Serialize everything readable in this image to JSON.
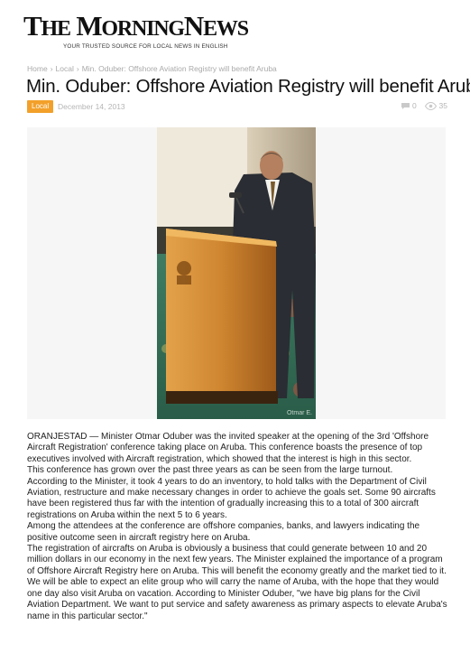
{
  "site": {
    "logo_the": "The",
    "logo_name": "MorningNews",
    "tagline": "YOUR TRUSTED SOURCE FOR LOCAL NEWS IN ENGLISH"
  },
  "breadcrumb": {
    "home": "Home",
    "section": "Local",
    "current": "Min. Oduber: Offshore Aviation Registry will benefit Aruba"
  },
  "article": {
    "title": "Min. Oduber: Offshore Aviation Registry will benefit Aruba",
    "category": "Local",
    "date": "December 14, 2013",
    "comments": "0",
    "views": "35",
    "photo_credit": "Otmar E.",
    "paragraphs": [
      "ORANJESTAD — Minister Otmar Oduber was the invited speaker at the opening of the 3rd 'Offshore Aircraft Registration' conference taking place on Aruba. This conference boasts the presence of top executives involved with Aircraft registration, which showed that the interest is high in this sector.",
      "This conference has grown over the past three years as can be seen from the large turnout.",
      "According to the Minister, it took 4 years to do an inventory, to hold talks with the Department of Civil Aviation, restructure and make necessary changes in order to achieve the goals set. Some 90 aircrafts have been registered thus far with the intention of gradually increasing this to a total of 300 aircraft registrations on Aruba within the next 5 to 6 years.",
      "Among the attendees at the conference are offshore companies, banks, and lawyers indicating the positive outcome seen in aircraft registry here on Aruba.",
      "The registration of aircrafts on Aruba is obviously a business that could generate between 10 and 20 million dollars in our economy in the next few years. The Minister explained the importance of a program of Offshore Aircraft Registry here on Aruba. This will benefit the economy greatly and the market tied to it. We will be able to expect an elite group who will carry the name of Aruba, with the hope that they would one day also visit Aruba on vacation. According to Minister Oduber, \"we have big plans for the Civil Aviation Department. We want to put service and safety awareness as primary aspects to elevate Aruba's name in this particular sector.\""
    ]
  },
  "colors": {
    "badge": "#f2a02a",
    "muted": "#b5b5b5"
  },
  "icons": {
    "comments": "comment-bubble-icon",
    "views": "eye-icon"
  }
}
